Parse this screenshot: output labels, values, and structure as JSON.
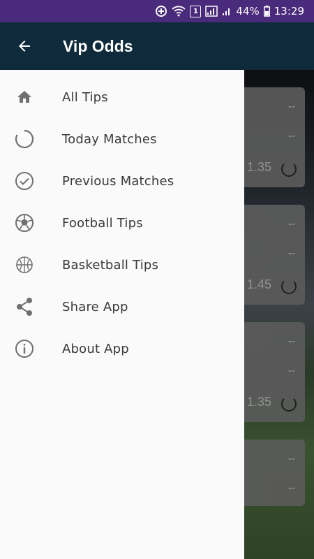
{
  "status": {
    "battery": "44%",
    "time": "13:29",
    "sim": "1"
  },
  "appbar": {
    "title": "Vip Odds"
  },
  "menu": [
    {
      "label": "All Tips",
      "icon": "home-icon"
    },
    {
      "label": "Today Matches",
      "icon": "loading-icon"
    },
    {
      "label": "Previous Matches",
      "icon": "check-circle-icon"
    },
    {
      "label": "Football Tips",
      "icon": "football-icon"
    },
    {
      "label": "Basketball Tips",
      "icon": "basketball-icon"
    },
    {
      "label": "Share App",
      "icon": "share-icon"
    },
    {
      "label": "About App",
      "icon": "info-icon"
    }
  ],
  "cards": [
    {
      "odds": "1.35",
      "dash": "--"
    },
    {
      "odds": "1.45",
      "dash": "--"
    },
    {
      "odds": "1.35",
      "dash": "--"
    },
    {
      "odds": "",
      "dash": "--"
    }
  ]
}
